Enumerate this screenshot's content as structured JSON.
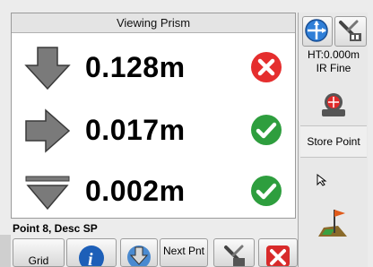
{
  "window": {
    "title": "Viewing Prism"
  },
  "readings": [
    {
      "direction": "down-arrow-icon",
      "value": "0.128m",
      "status": "error"
    },
    {
      "direction": "right-arrow-icon",
      "value": "0.017m",
      "status": "ok"
    },
    {
      "direction": "level-icon",
      "value": "0.002m",
      "status": "ok"
    }
  ],
  "sidebar": {
    "ht_line1": "HT:0.000m",
    "ht_line2": "IR Fine",
    "store_point_label": "Store Point"
  },
  "point": {
    "label": "Point 8, Desc SP"
  },
  "toolbar": {
    "grid_label": "Grid",
    "next_pnt_label": "Next Pnt"
  },
  "colors": {
    "error": "#e52e2e",
    "ok": "#2e9e3e",
    "arrow": "#7a7a7a",
    "info": "#1d5fb8"
  }
}
